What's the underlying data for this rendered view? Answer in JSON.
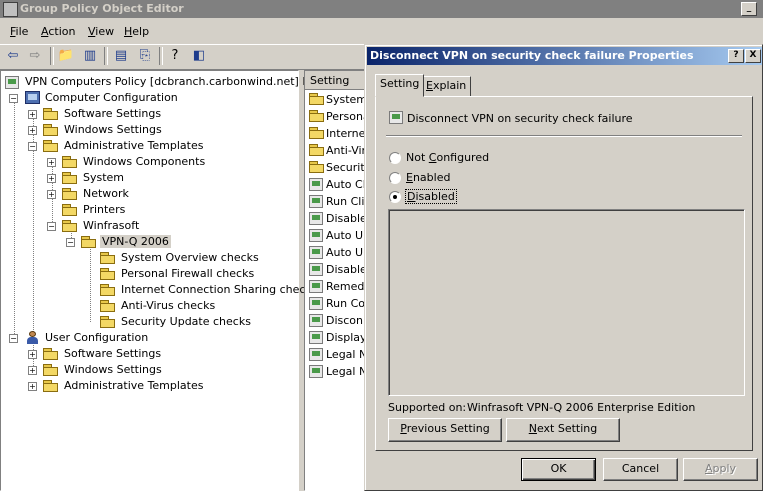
{
  "window": {
    "title": "Group Policy Object Editor"
  },
  "menu": [
    {
      "pre": "",
      "u": "F",
      "post": "ile"
    },
    {
      "pre": "",
      "u": "A",
      "post": "ction"
    },
    {
      "pre": "",
      "u": "V",
      "post": "iew"
    },
    {
      "pre": "",
      "u": "H",
      "post": "elp"
    }
  ],
  "tree": {
    "root": "VPN Computers Policy [dcbranch.carbonwind.net] Policy",
    "computer_config": "Computer Configuration",
    "cc_software": "Software Settings",
    "cc_windows": "Windows Settings",
    "cc_admin": "Administrative Templates",
    "windows_components": "Windows Components",
    "system": "System",
    "network": "Network",
    "printers": "Printers",
    "winfrasoft": "Winfrasoft",
    "vpnq": "VPN-Q 2006",
    "system_overview": "System Overview checks",
    "personal_firewall": "Personal Firewall checks",
    "ics": "Internet Connection Sharing checks",
    "antivirus": "Anti-Virus checks",
    "security_update": "Security Update checks",
    "user_config": "User Configuration",
    "uc_software": "Software Settings",
    "uc_windows": "Windows Settings",
    "uc_admin": "Administrative Templates"
  },
  "list": {
    "header": "Setting",
    "rows": [
      {
        "text": "System",
        "kind": "folder"
      },
      {
        "text": "Persona",
        "kind": "folder"
      },
      {
        "text": "Internet",
        "kind": "folder"
      },
      {
        "text": "Anti-Viru",
        "kind": "folder"
      },
      {
        "text": "Security",
        "kind": "folder"
      },
      {
        "text": "Auto Clo",
        "kind": "policy"
      },
      {
        "text": "Run Clie",
        "kind": "policy"
      },
      {
        "text": "Disable",
        "kind": "policy"
      },
      {
        "text": "Auto Up",
        "kind": "policy"
      },
      {
        "text": "Auto Up",
        "kind": "policy"
      },
      {
        "text": "Disable",
        "kind": "policy"
      },
      {
        "text": "Remedia",
        "kind": "policy"
      },
      {
        "text": "Run Con",
        "kind": "policy"
      },
      {
        "text": "Disconn",
        "kind": "policy"
      },
      {
        "text": "Display",
        "kind": "policy"
      },
      {
        "text": "Legal No",
        "kind": "policy"
      },
      {
        "text": "Legal No",
        "kind": "policy"
      }
    ]
  },
  "dialog": {
    "title": "Disconnect VPN on security check failure Properties",
    "help": "?",
    "close": "X",
    "tab_setting": "Setting",
    "tab_explain_pre": "",
    "tab_explain_u": "E",
    "tab_explain_post": "xplain",
    "policy_name": "Disconnect VPN on security check failure",
    "opt_nc_pre": "Not ",
    "opt_nc_u": "C",
    "opt_nc_post": "onfigured",
    "opt_en_pre": "",
    "opt_en_u": "E",
    "opt_en_post": "nabled",
    "opt_dis_pre": "",
    "opt_dis_u": "D",
    "opt_dis_post": "isabled",
    "supported_label": "Supported on:",
    "supported_value": "Winfrasoft VPN-Q 2006 Enterprise Edition",
    "prev_pre": "",
    "prev_u": "P",
    "prev_post": "revious Setting",
    "next_pre": "",
    "next_u": "N",
    "next_post": "ext Setting",
    "ok": "OK",
    "cancel": "Cancel",
    "apply_pre": "",
    "apply_u": "A",
    "apply_post": "pply",
    "selected_option": "Disabled"
  }
}
